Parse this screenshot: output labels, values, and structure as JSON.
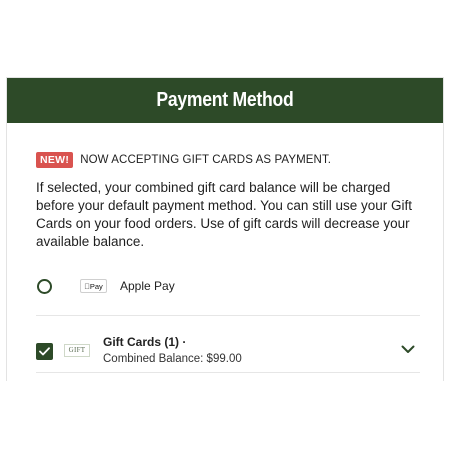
{
  "modal": {
    "title": "Payment Method"
  },
  "notice": {
    "badge": "NEW!",
    "text": "NOW ACCEPTING GIFT CARDS AS PAYMENT."
  },
  "description": "If selected, your combined gift card balance will be charged before your default payment method. You can still use your Gift Cards on your food orders. Use of gift cards will decrease your available balance.",
  "payment_options": {
    "apple_pay": {
      "logo_text": "Pay",
      "label": "Apple Pay",
      "selected": false
    },
    "gift_cards": {
      "logo_text": "GIFT",
      "title": "Gift Cards (1) ·",
      "balance": "Combined Balance: $99.00",
      "selected": true
    }
  },
  "colors": {
    "brand_green": "#2d4a28",
    "badge_red": "#d9534f"
  },
  "icons": {
    "checkbox": "checkmark-icon",
    "expand": "chevron-down-icon"
  }
}
